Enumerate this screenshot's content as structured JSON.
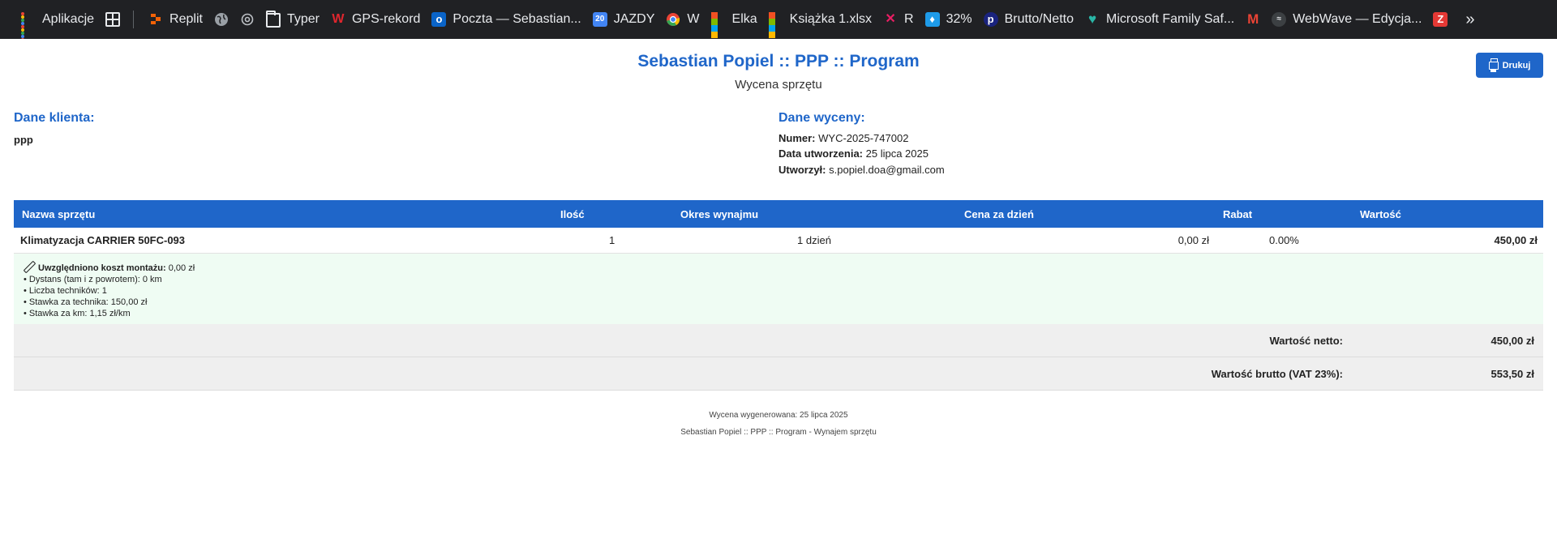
{
  "bookmarks": [
    {
      "label": "Aplikacje",
      "icon": "apps-icon"
    },
    {
      "label": "",
      "icon": "grid-icon"
    },
    {
      "label": "Replit",
      "icon": "replit-icon"
    },
    {
      "label": "",
      "icon": "globe-icon"
    },
    {
      "label": "",
      "icon": "openai-icon"
    },
    {
      "label": "Typer",
      "icon": "folder-icon"
    },
    {
      "label": "GPS-rekord",
      "icon": "gps-rekord-icon"
    },
    {
      "label": "Poczta — Sebastian...",
      "icon": "outlook-icon"
    },
    {
      "label": "JAZDY",
      "icon": "calendar-icon"
    },
    {
      "label": "W",
      "icon": "chrome-icon"
    },
    {
      "label": "Elka",
      "icon": "microsoft-icon"
    },
    {
      "label": "Książka 1.xlsx",
      "icon": "microsoft-icon"
    },
    {
      "label": "R",
      "icon": "r-icon"
    },
    {
      "label": "32%",
      "icon": "bulb-icon"
    },
    {
      "label": "Brutto/Netto",
      "icon": "p-icon"
    },
    {
      "label": "Microsoft Family Saf...",
      "icon": "heart-icon"
    },
    {
      "label": "",
      "icon": "gmail-icon"
    },
    {
      "label": "WebWave — Edycja...",
      "icon": "webwave-icon"
    },
    {
      "label": "",
      "icon": "z-icon"
    }
  ],
  "header": {
    "title": "Sebastian Popiel :: PPP :: Program",
    "subtitle": "Wycena sprzętu",
    "print_label": "Drukuj"
  },
  "client": {
    "heading": "Dane klienta:",
    "name": "ppp"
  },
  "quote": {
    "heading": "Dane wyceny:",
    "number_label": "Numer:",
    "number": "WYC-2025-747002",
    "created_label": "Data utworzenia:",
    "created": "25 lipca 2025",
    "author_label": "Utworzył:",
    "author": "s.popiel.doa@gmail.com"
  },
  "table": {
    "columns": [
      "Nazwa sprzętu",
      "Ilość",
      "Okres wynajmu",
      "Cena za dzień",
      "Rabat",
      "Wartość"
    ],
    "row": {
      "name": "Klimatyzacja CARRIER 50FC-093",
      "qty": "1",
      "period": "1 dzień",
      "price": "0,00 zł",
      "discount": "0.00%",
      "value": "450,00 zł"
    },
    "install": {
      "label": "Uwzględniono koszt montażu:",
      "cost": "0,00 zł",
      "lines": [
        "• Dystans (tam i z powrotem): 0 km",
        "• Liczba techników: 1",
        "• Stawka za technika: 150,00 zł",
        "• Stawka za km: 1,15 zł/km"
      ]
    },
    "net_label": "Wartość netto:",
    "net_value": "450,00 zł",
    "gross_label": "Wartość brutto (VAT 23%):",
    "gross_value": "553,50 zł"
  },
  "footer": {
    "line1": "Wycena wygenerowana: 25 lipca 2025",
    "line2": "Sebastian Popiel :: PPP :: Program - Wynajem sprzętu"
  }
}
